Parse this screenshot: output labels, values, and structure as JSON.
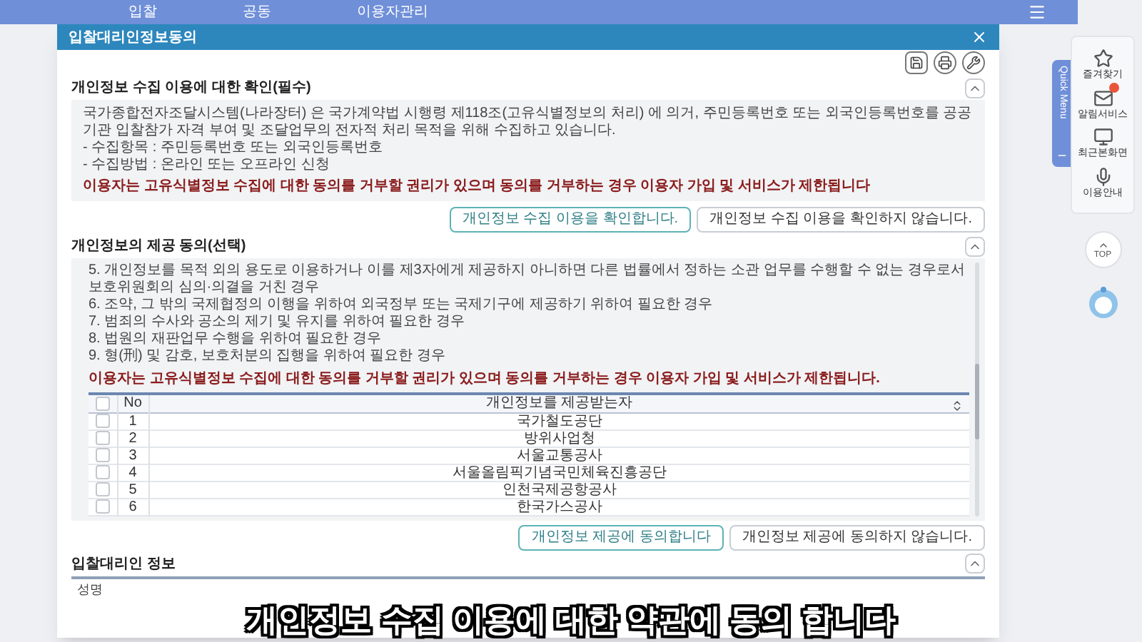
{
  "nav": {
    "items": [
      "입찰",
      "공동",
      "이용자관리"
    ]
  },
  "dialog": {
    "title": "입찰대리인정보동의",
    "sections": [
      {
        "kind": "notice",
        "title": "개인정보 수집 이용에 대한 확인(필수)",
        "expanded": true,
        "lines": [
          "국가종합전자조달시스템(나라장터) 은 국가계약법 시행령 제118조(고유식별정보의 처리) 에 의거, 주민등록번호 또는 외국인등록번호를 공공기관 입찰참가 자격 부여 및 조달업무의 전자적 처리 목적을 위해 수집하고 있습니다.",
          "- 수집항목 : 주민등록번호 또는 외국인등록번호",
          "- 수집방법 : 온라인 또는 오프라인 신청"
        ],
        "warning": "이용자는 고유식별정보 수집에 대한 동의를 거부할 권리가 있으며 동의를 거부하는 경우 이용자 가입 및 서비스가 제한됩니다",
        "buttons": [
          {
            "label": "개인정보 수집 이용을 확인합니다.",
            "selected": true
          },
          {
            "label": "개인정보 수집 이용을 확인하지 않습니다.",
            "selected": false
          }
        ]
      },
      {
        "kind": "table",
        "title": "개인정보의 제공 동의(선택)",
        "expanded": true,
        "lines": [
          "5. 개인정보를 목적 외의 용도로 이용하거나 이를 제3자에게 제공하지 아니하면 다른 법률에서 정하는 소관 업무를 수행할 수 없는 경우로서 보호위원회의 심의·의결을 거친 경우",
          "6. 조약, 그 밖의 국제협정의 이행을 위하여 외국정부 또는 국제기구에 제공하기 위하여 필요한 경우",
          "7. 범죄의 수사와 공소의 제기 및 유지를 위하여 필요한 경우",
          "8. 법원의 재판업무 수행을 위하여 필요한 경우",
          "9. 형(刑) 및 감호, 보호처분의 집행을 위하여 필요한 경우"
        ],
        "warning": "이용자는 고유식별정보 수집에 대한 동의를 거부할 권리가 있으며 동의를 거부하는 경우 이용자 가입 및 서비스가 제한됩니다.",
        "table": {
          "columns": [
            "No",
            "개인정보를 제공받는자"
          ],
          "all_checked": false,
          "rows": [
            {
              "no": "1",
              "name": "국가철도공단",
              "checked": false
            },
            {
              "no": "2",
              "name": "방위사업청",
              "checked": false
            },
            {
              "no": "3",
              "name": "서울교통공사",
              "checked": false
            },
            {
              "no": "4",
              "name": "서울올림픽기념국민체육진흥공단",
              "checked": false
            },
            {
              "no": "5",
              "name": "인천국제공항공사",
              "checked": false
            },
            {
              "no": "6",
              "name": "한국가스공사",
              "checked": false
            }
          ]
        },
        "buttons": [
          {
            "label": "개인정보 제공에 동의합니다",
            "selected": true
          },
          {
            "label": "개인정보 제공에 동의하지 않습니다.",
            "selected": false
          }
        ]
      },
      {
        "kind": "fields",
        "title": "입찰대리인 정보",
        "expanded": true,
        "fields": [
          "성명"
        ]
      }
    ]
  },
  "quick_menu": {
    "title": "Quick Menu",
    "items": [
      {
        "kind": "star",
        "label": "즐겨찾기"
      },
      {
        "kind": "alert",
        "label": "알림서비스"
      },
      {
        "kind": "monitor",
        "label": "최근본화면"
      },
      {
        "kind": "mic",
        "label": "이용안내"
      }
    ],
    "top": "TOP"
  },
  "caption": "개인정보 수집 이용에 대한 약관에 동의 합니다"
}
